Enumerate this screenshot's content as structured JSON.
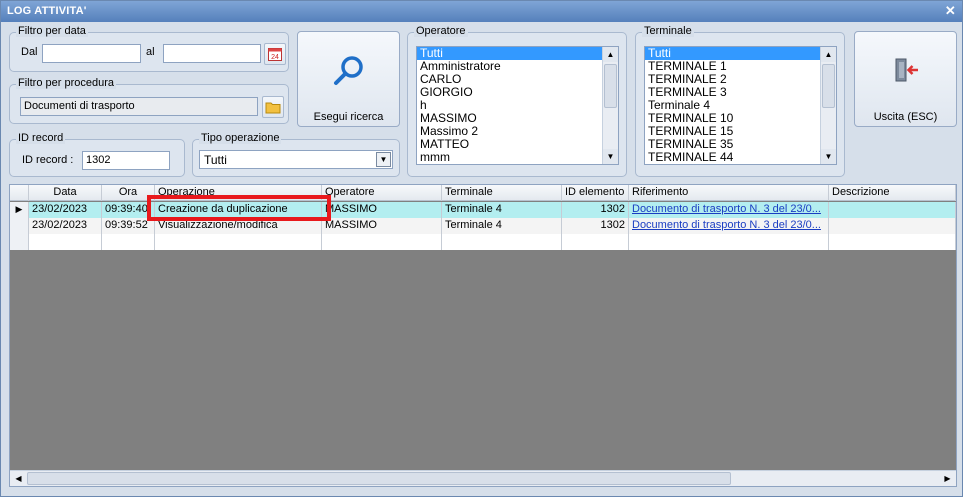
{
  "window": {
    "title": "LOG ATTIVITA'"
  },
  "filter_date": {
    "legend": "Filtro per data",
    "from_label": "Dal",
    "from_value": "",
    "to_label": "al",
    "to_value": ""
  },
  "filter_procedure": {
    "legend": "Filtro per procedura",
    "value": "Documenti di trasporto"
  },
  "search_button": {
    "label": "Esegui ricerca"
  },
  "id_record": {
    "legend": "ID record",
    "label": "ID record :",
    "value": "1302"
  },
  "operation_type": {
    "legend": "Tipo operazione",
    "value": "Tutti"
  },
  "operators": {
    "legend": "Operatore",
    "items": [
      "Tutti",
      "Amministratore",
      "CARLO",
      "GIORGIO",
      "h",
      "MASSIMO",
      "Massimo 2",
      "MATTEO",
      "mmm"
    ],
    "selected_index": 0
  },
  "terminals": {
    "legend": "Terminale",
    "items": [
      "Tutti",
      "TERMINALE 1",
      "TERMINALE 2",
      "TERMINALE 3",
      "Terminale 4",
      "TERMINALE 10",
      "TERMINALE 15",
      "TERMINALE 35",
      "TERMINALE 44"
    ],
    "selected_index": 0
  },
  "exit_button": {
    "label": "Uscita (ESC)"
  },
  "table": {
    "columns": [
      "Data",
      "Ora",
      "Operazione",
      "Operatore",
      "Terminale",
      "ID elemento",
      "Riferimento",
      "Descrizione"
    ],
    "rows": [
      [
        "23/02/2023",
        "09:39:40",
        "Creazione da duplicazione",
        "MASSIMO",
        "Terminale 4",
        "1302",
        "Documento di trasporto N. 3 del 23/0...",
        ""
      ],
      [
        "23/02/2023",
        "09:39:52",
        "Visualizzazione/modifica",
        "MASSIMO",
        "Terminale 4",
        "1302",
        "Documento di trasporto N. 3 del 23/0...",
        ""
      ]
    ],
    "current_row_indicator": "▶"
  },
  "colors": {
    "title_bar": "#5580bb",
    "selected_row": "#b3eef0",
    "highlight_box": "#e8191c",
    "list_selection": "#3399ff"
  }
}
